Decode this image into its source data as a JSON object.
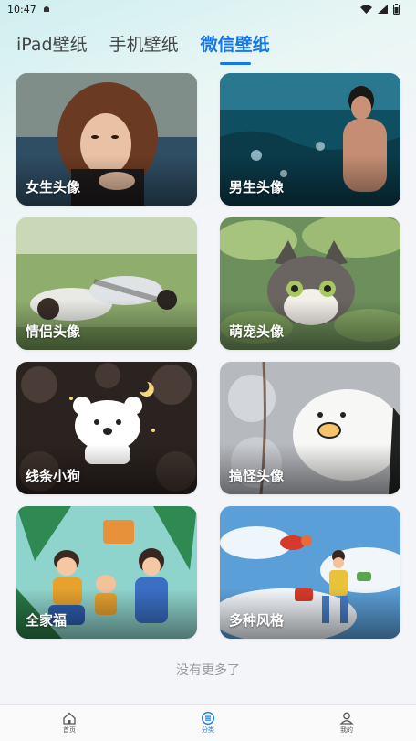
{
  "status_bar": {
    "time": "10:47"
  },
  "tabs": [
    {
      "label": "iPad壁纸"
    },
    {
      "label": "手机壁纸"
    },
    {
      "label": "微信壁纸"
    }
  ],
  "active_tab": "微信壁纸",
  "categories": [
    {
      "label": "女生头像"
    },
    {
      "label": "男生头像"
    },
    {
      "label": "情侣头像"
    },
    {
      "label": "萌宠头像"
    },
    {
      "label": "线条小狗"
    },
    {
      "label": "搞怪头像"
    },
    {
      "label": "全家福"
    },
    {
      "label": "多种风格"
    }
  ],
  "footer": {
    "no_more": "没有更多了"
  },
  "bottom_nav": [
    {
      "label": "首页"
    },
    {
      "label": "分类"
    },
    {
      "label": "我的"
    }
  ],
  "colors": {
    "accent": "#1677e8"
  }
}
